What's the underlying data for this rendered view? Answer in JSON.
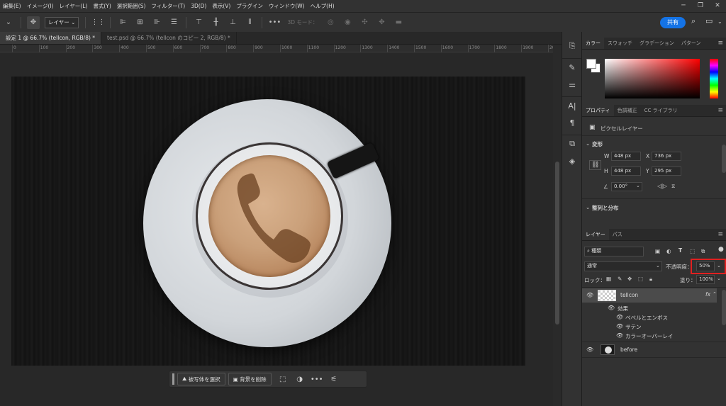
{
  "menubar": {
    "items": [
      "編集(E)",
      "イメージ(I)",
      "レイヤー(L)",
      "書式(Y)",
      "選択範囲(S)",
      "フィルター(T)",
      "3D(D)",
      "表示(V)",
      "プラグイン",
      "ウィンドウ(W)",
      "ヘルプ(H)"
    ]
  },
  "options": {
    "layer_select": "レイヤー",
    "mode3d": "3D モード：",
    "share": "共有"
  },
  "tabs": [
    {
      "label": "設定 1 @ 66.7% (tellcon, RGB/8) *",
      "active": true
    },
    {
      "label": "test.psd @ 66.7% (tellcon のコピー 2, RGB/8) *",
      "active": false
    }
  ],
  "ruler": {
    "ticks": [
      "0",
      "100",
      "200",
      "300",
      "400",
      "500",
      "600",
      "700",
      "800",
      "900",
      "1000",
      "1100",
      "1200",
      "1300",
      "1400",
      "1500",
      "1600",
      "1700",
      "1800",
      "1900",
      "20"
    ]
  },
  "context_bar": {
    "select_subject": "被写体を選択",
    "remove_bg": "背景を削除"
  },
  "color_panel": {
    "tabs": [
      "カラー",
      "スウォッチ",
      "グラデーション",
      "パターン"
    ]
  },
  "properties": {
    "tabs": [
      "プロパティ",
      "色調補正",
      "CC ライブラリ"
    ],
    "layer_type": "ピクセルレイヤー",
    "transform_title": "変形",
    "w_label": "W",
    "w_value": "448 px",
    "h_label": "H",
    "h_value": "448 px",
    "x_label": "X",
    "x_value": "736 px",
    "y_label": "Y",
    "y_value": "295 px",
    "angle": "0.00°",
    "align_title": "整列と分布"
  },
  "layers": {
    "tabs": [
      "レイヤー",
      "パス"
    ],
    "filter_kind": "種類",
    "blend_mode": "通常",
    "opacity_label": "不透明度：",
    "opacity_value": "50%",
    "lock_label": "ロック：",
    "fill_label": "塗り：",
    "fill_value": "100%",
    "rows": {
      "tellcon": "tellcon",
      "effects": "効果",
      "bevel": "ベベルとエンボス",
      "satin": "サテン",
      "color_overlay": "カラーオーバーレイ",
      "before": "before"
    },
    "fx": "fx"
  },
  "colors": {
    "accent": "#1473e6",
    "highlight": "#e02020"
  }
}
